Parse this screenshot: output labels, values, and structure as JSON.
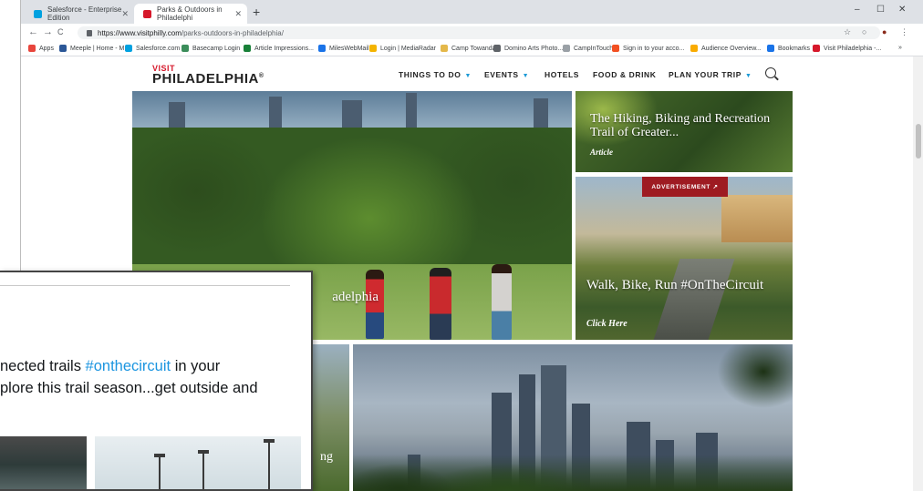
{
  "browser": {
    "tabs": [
      {
        "title": "Salesforce - Enterprise Edition",
        "favicon_color": "#00a1e0"
      },
      {
        "title": "Parks & Outdoors in Philadelphi",
        "favicon_color": "#d6182b"
      }
    ],
    "new_tab_label": "+",
    "window_controls": {
      "minimize": "–",
      "maximize": "☐",
      "close": "✕"
    },
    "nav": {
      "back": "←",
      "forward": "→",
      "reload": "C"
    },
    "url": {
      "host": "https://www.visitphilly.com",
      "path": "/parks-outdoors-in-philadelphia/"
    },
    "bookmarks": [
      {
        "label": "Apps",
        "color": "#e8453c"
      },
      {
        "label": "Meeple | Home - M...",
        "color": "#2b5797"
      },
      {
        "label": "Salesforce.com",
        "color": "#00a1e0"
      },
      {
        "label": "Basecamp Login",
        "color": "#3b8d5a"
      },
      {
        "label": "Article Impressions...",
        "color": "#188038"
      },
      {
        "label": "MilesWebMail",
        "color": "#1a73e8"
      },
      {
        "label": "Login | MediaRadar",
        "color": "#f4b400"
      },
      {
        "label": "Camp Towanda",
        "color": "#e4b84a"
      },
      {
        "label": "Domino Arts Photo...",
        "color": "#5f6368"
      },
      {
        "label": "CampInTouch",
        "color": "#9aa0a6"
      },
      {
        "label": "Sign in to your acco...",
        "color": "#f25022"
      },
      {
        "label": "Audience Overview...",
        "color": "#f9ab00"
      },
      {
        "label": "Bookmarks",
        "color": "#1a73e8"
      },
      {
        "label": "Visit Philadelphia -...",
        "color": "#d6182b"
      }
    ],
    "bookmarks_more": "»"
  },
  "site": {
    "logo_visit": "VISIT",
    "logo_name": "PHILADELPHIA",
    "logo_mark": "®",
    "nav": [
      {
        "label": "THINGS TO DO",
        "dropdown": "▼"
      },
      {
        "label": "EVENTS",
        "dropdown": "▼"
      },
      {
        "label": "HOTELS",
        "dropdown": ""
      },
      {
        "label": "FOOD & DRINK",
        "dropdown": ""
      },
      {
        "label": "PLAN YOUR TRIP",
        "dropdown": "▼"
      }
    ],
    "accent": "#d6182b",
    "link_blue": "#1c9ad6"
  },
  "hero": {
    "title": "adelphia"
  },
  "cards": {
    "trail": {
      "title": "The Hiking, Biking and Recreation Trail of Greater...",
      "kind": "Article"
    },
    "ad": {
      "badge": "ADVERTISEMENT ↗",
      "title": "Walk, Bike, Run #OnTheCircuit",
      "cta": "Click Here"
    },
    "lower_left": {
      "title": "ng"
    }
  },
  "overlay": {
    "line1_pre": "nected trails ",
    "hashtag": "#onthecircuit",
    "line1_post": " in your",
    "line2": "plore this trail season...get outside and"
  }
}
